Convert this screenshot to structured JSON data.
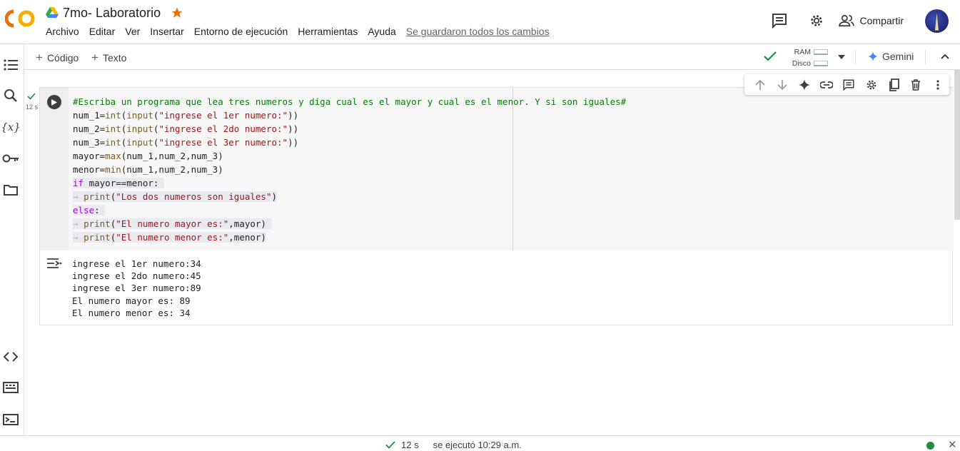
{
  "app": {
    "logo_text": "CO",
    "title": "7mo- Laboratorio",
    "menu": [
      "Archivo",
      "Editar",
      "Ver",
      "Insertar",
      "Entorno de ejecución",
      "Herramientas",
      "Ayuda"
    ],
    "saved_status": "Se guardaron todos los cambios",
    "share_label": "Compartir",
    "accent_orange": "#f9ab00",
    "star_color": "#e8710a"
  },
  "toolbar": {
    "add_code": "Código",
    "add_text": "Texto",
    "ram_label": "RAM",
    "disk_label": "Disco",
    "gemini_label": "Gemini"
  },
  "sidebar": {
    "icons": [
      "toc-icon",
      "search-icon",
      "variables-icon",
      "key-icon",
      "folder-icon",
      "code-snippets-icon",
      "command-palette-icon",
      "terminal-icon"
    ],
    "variables_glyph": "{x}"
  },
  "cell": {
    "exec_time": "12 s",
    "code_lines": [
      "#Escriba un programa que lea tres numeros y diga cual es el mayor y cual es el menor. Y si son iguales#",
      "num_1=int(input(\"ingrese el 1er numero:\"))",
      "num_2=int(input(\"ingrese el 2do numero:\"))",
      "num_3=int(input(\"ingrese el 3er numero:\"))",
      "mayor=max(num_1,num_2,num_3)",
      "menor=min(num_1,num_2,num_3)",
      "if mayor==menor:",
      "  print(\"Los dos numeros son iguales\")",
      "else:",
      "  print(\"El numero mayor es:\",mayor)",
      "  print(\"El numero menor es:\",menor)"
    ],
    "output_lines": [
      "ingrese el 1er numero:34",
      "ingrese el 2do numero:45",
      "ingrese el 3er numero:89",
      "El numero mayor es: 89",
      "El numero menor es: 34"
    ]
  },
  "status_bar": {
    "duration": "12 s",
    "executed": "se ejecutó 10:29 a.m."
  }
}
